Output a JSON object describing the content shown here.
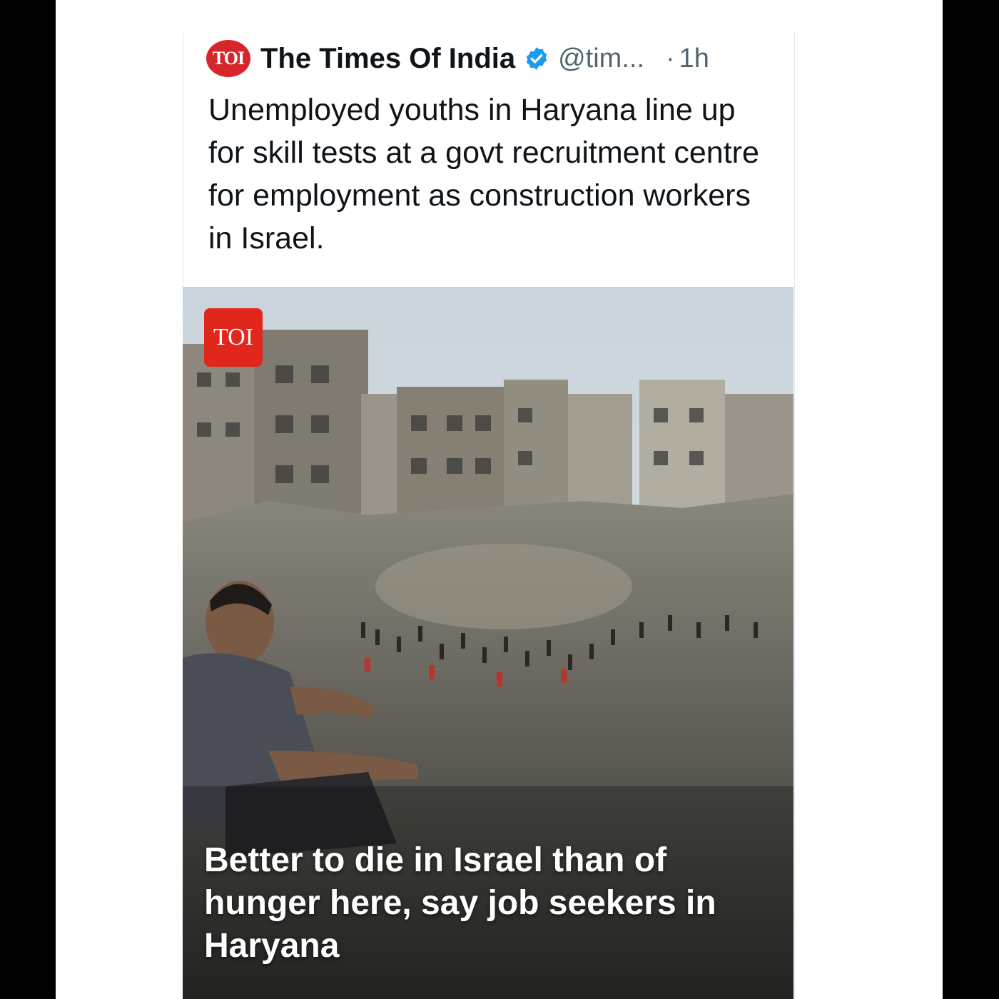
{
  "tweet": {
    "logo_text": "TOI",
    "author": "The Times Of India",
    "handle": "@tim...",
    "separator": "·",
    "time": "1h",
    "text": "Unemployed youths in Haryana line up for skill tests at a govt recruitment centre for employment as construction workers in Israel."
  },
  "media": {
    "badge": "TOI",
    "headline": "Better to die in Israel than of hunger here, say job seekers in Haryana"
  },
  "colors": {
    "brand_red": "#d7262b",
    "verified_blue": "#1d9bf0",
    "text_primary": "#0f1419",
    "text_secondary": "#536471"
  }
}
